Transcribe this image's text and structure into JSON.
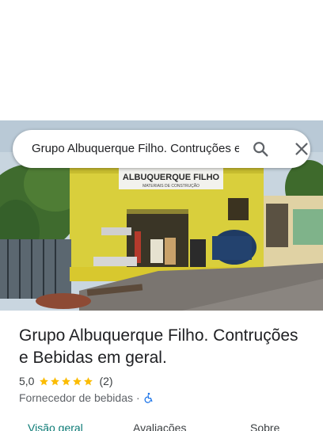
{
  "search": {
    "query": "Grupo Albuquerque Filho. Contruções e Bebidas em geral."
  },
  "photo": {
    "sign_text": "ALBUQUERQUE FILHO",
    "sign_subtext": "MATERIAIS DE CONSTRUÇÃO"
  },
  "place": {
    "title": "Grupo Albuquerque Filho. Contruções e Bebidas em geral.",
    "rating": "5,0",
    "stars": 5,
    "review_count": "(2)",
    "category": "Fornecedor de bebidas",
    "separator": "·"
  },
  "tabs": [
    {
      "label": "Visão geral",
      "active": true
    },
    {
      "label": "Avaliações",
      "active": false
    },
    {
      "label": "Sobre",
      "active": false
    }
  ],
  "colors": {
    "star": "#fbbc04",
    "accent": "#0b7a75",
    "accessibility": "#1a73e8"
  },
  "icons": {
    "search": "search-icon",
    "close": "close-icon",
    "accessibility": "wheelchair-icon",
    "star": "star-icon"
  }
}
